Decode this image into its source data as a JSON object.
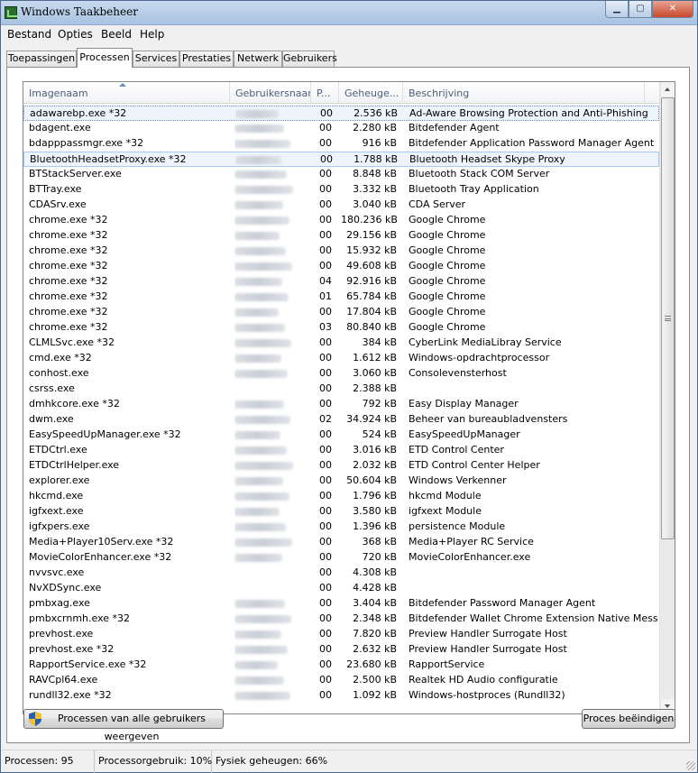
{
  "window": {
    "title": "Windows Taakbeheer",
    "controls": {
      "minimize": "▁",
      "maximize": "▢",
      "close": "✕"
    }
  },
  "menu": [
    "Bestand",
    "Opties",
    "Beeld",
    "Help"
  ],
  "tabs": [
    {
      "label": "Toepassingen",
      "active": false
    },
    {
      "label": "Processen",
      "active": true
    },
    {
      "label": "Services",
      "active": false
    },
    {
      "label": "Prestaties",
      "active": false
    },
    {
      "label": "Netwerk",
      "active": false
    },
    {
      "label": "Gebruikers",
      "active": false
    }
  ],
  "table": {
    "columns": [
      "Imagenaam",
      "Gebruikersnaam",
      "P...",
      "Geheuge...",
      "Beschrijving"
    ],
    "sorted_column": "Imagenaam",
    "rows": [
      {
        "name": "adawarebp.exe *32",
        "cpu": "00",
        "mem": "2.536 kB",
        "desc": "Ad-Aware Browsing Protection and Anti-Phishing",
        "user": true,
        "state": "focus"
      },
      {
        "name": "bdagent.exe",
        "cpu": "00",
        "mem": "2.280 kB",
        "desc": "Bitdefender Agent",
        "user": true
      },
      {
        "name": "bdapppassmgr.exe *32",
        "cpu": "00",
        "mem": "916 kB",
        "desc": "Bitdefender Application Password Manager Agent",
        "user": true
      },
      {
        "name": "BluetoothHeadsetProxy.exe *32",
        "cpu": "00",
        "mem": "1.788 kB",
        "desc": "Bluetooth Headset Skype Proxy",
        "user": true,
        "state": "sel"
      },
      {
        "name": "BTStackServer.exe",
        "cpu": "00",
        "mem": "8.848 kB",
        "desc": "Bluetooth Stack COM Server",
        "user": true
      },
      {
        "name": "BTTray.exe",
        "cpu": "00",
        "mem": "3.332 kB",
        "desc": "Bluetooth Tray Application",
        "user": true
      },
      {
        "name": "CDASrv.exe",
        "cpu": "00",
        "mem": "3.040 kB",
        "desc": "CDA Server",
        "user": true
      },
      {
        "name": "chrome.exe *32",
        "cpu": "00",
        "mem": "180.236 kB",
        "desc": "Google Chrome",
        "user": true
      },
      {
        "name": "chrome.exe *32",
        "cpu": "00",
        "mem": "29.156 kB",
        "desc": "Google Chrome",
        "user": true
      },
      {
        "name": "chrome.exe *32",
        "cpu": "00",
        "mem": "15.932 kB",
        "desc": "Google Chrome",
        "user": true
      },
      {
        "name": "chrome.exe *32",
        "cpu": "00",
        "mem": "49.608 kB",
        "desc": "Google Chrome",
        "user": true
      },
      {
        "name": "chrome.exe *32",
        "cpu": "04",
        "mem": "92.916 kB",
        "desc": "Google Chrome",
        "user": true
      },
      {
        "name": "chrome.exe *32",
        "cpu": "01",
        "mem": "65.784 kB",
        "desc": "Google Chrome",
        "user": true
      },
      {
        "name": "chrome.exe *32",
        "cpu": "00",
        "mem": "17.804 kB",
        "desc": "Google Chrome",
        "user": true
      },
      {
        "name": "chrome.exe *32",
        "cpu": "03",
        "mem": "80.840 kB",
        "desc": "Google Chrome",
        "user": true
      },
      {
        "name": "CLMLSvc.exe *32",
        "cpu": "00",
        "mem": "384 kB",
        "desc": "CyberLink MediaLibray Service",
        "user": true
      },
      {
        "name": "cmd.exe *32",
        "cpu": "00",
        "mem": "1.612 kB",
        "desc": "Windows-opdrachtprocessor",
        "user": true
      },
      {
        "name": "conhost.exe",
        "cpu": "00",
        "mem": "3.060 kB",
        "desc": "Consolevensterhost",
        "user": true
      },
      {
        "name": "csrss.exe",
        "cpu": "00",
        "mem": "2.388 kB",
        "desc": "",
        "user": false
      },
      {
        "name": "dmhkcore.exe *32",
        "cpu": "00",
        "mem": "792 kB",
        "desc": "Easy Display Manager",
        "user": true
      },
      {
        "name": "dwm.exe",
        "cpu": "02",
        "mem": "34.924 kB",
        "desc": "Beheer van bureaubladvensters",
        "user": true
      },
      {
        "name": "EasySpeedUpManager.exe *32",
        "cpu": "00",
        "mem": "524 kB",
        "desc": "EasySpeedUpManager",
        "user": true
      },
      {
        "name": "ETDCtrl.exe",
        "cpu": "00",
        "mem": "3.016 kB",
        "desc": "ETD Control Center",
        "user": true
      },
      {
        "name": "ETDCtrlHelper.exe",
        "cpu": "00",
        "mem": "2.032 kB",
        "desc": "ETD Control Center Helper",
        "user": true
      },
      {
        "name": "explorer.exe",
        "cpu": "00",
        "mem": "50.604 kB",
        "desc": "Windows Verkenner",
        "user": true
      },
      {
        "name": "hkcmd.exe",
        "cpu": "00",
        "mem": "1.796 kB",
        "desc": "hkcmd Module",
        "user": true
      },
      {
        "name": "igfxext.exe",
        "cpu": "00",
        "mem": "3.580 kB",
        "desc": "igfxext Module",
        "user": true
      },
      {
        "name": "igfxpers.exe",
        "cpu": "00",
        "mem": "1.396 kB",
        "desc": "persistence Module",
        "user": true
      },
      {
        "name": "Media+Player10Serv.exe *32",
        "cpu": "00",
        "mem": "368 kB",
        "desc": "Media+Player RC Service",
        "user": true
      },
      {
        "name": "MovieColorEnhancer.exe *32",
        "cpu": "00",
        "mem": "720 kB",
        "desc": "MovieColorEnhancer.exe",
        "user": true
      },
      {
        "name": "nvvsvc.exe",
        "cpu": "00",
        "mem": "4.308 kB",
        "desc": "",
        "user": false
      },
      {
        "name": "NvXDSync.exe",
        "cpu": "00",
        "mem": "4.428 kB",
        "desc": "",
        "user": false
      },
      {
        "name": "pmbxag.exe",
        "cpu": "00",
        "mem": "3.404 kB",
        "desc": "Bitdefender Password Manager Agent",
        "user": true
      },
      {
        "name": "pmbxcrnmh.exe *32",
        "cpu": "00",
        "mem": "2.348 kB",
        "desc": "Bitdefender Wallet Chrome Extension Native Mess...",
        "user": true
      },
      {
        "name": "prevhost.exe",
        "cpu": "00",
        "mem": "7.820 kB",
        "desc": "Preview Handler Surrogate Host",
        "user": true
      },
      {
        "name": "prevhost.exe *32",
        "cpu": "00",
        "mem": "2.632 kB",
        "desc": "Preview Handler Surrogate Host",
        "user": true
      },
      {
        "name": "RapportService.exe *32",
        "cpu": "00",
        "mem": "23.680 kB",
        "desc": "RapportService",
        "user": true
      },
      {
        "name": "RAVCpl64.exe",
        "cpu": "00",
        "mem": "2.500 kB",
        "desc": "Realtek HD Audio configuratie",
        "user": true
      },
      {
        "name": "rundll32.exe *32",
        "cpu": "00",
        "mem": "1.092 kB",
        "desc": "Windows-hostproces (Rundll32)",
        "user": true
      }
    ]
  },
  "buttons": {
    "show_all": "Processen van alle gebruikers weergeven",
    "end_process": "Proces beëindigen"
  },
  "status": {
    "processes": "Processen: 95",
    "cpu": "Processorgebruik: 10%",
    "memory": "Fysiek geheugen: 66%"
  }
}
